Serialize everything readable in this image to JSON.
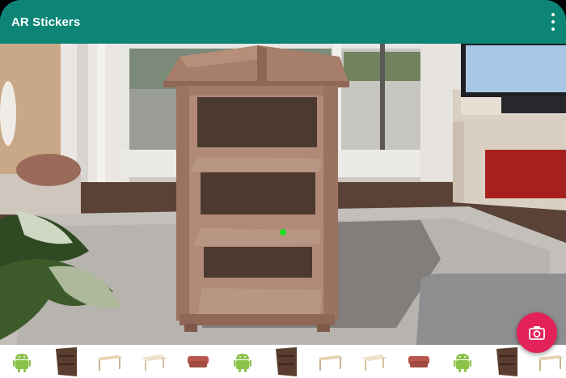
{
  "app": {
    "title": "AR Stickers"
  },
  "menu": {
    "icon": "more-vert-icon"
  },
  "camera_button": {
    "icon": "camera-icon",
    "color": "#e3225a"
  },
  "ar_scene": {
    "placed_object": "bookshelf",
    "tracking_point_color": "#18e024"
  },
  "sticker_tray": {
    "items": [
      {
        "type": "android"
      },
      {
        "type": "bookshelf"
      },
      {
        "type": "desk"
      },
      {
        "type": "table"
      },
      {
        "type": "sofa"
      },
      {
        "type": "android"
      },
      {
        "type": "bookshelf"
      },
      {
        "type": "desk"
      },
      {
        "type": "table"
      },
      {
        "type": "sofa"
      },
      {
        "type": "android"
      },
      {
        "type": "bookshelf"
      },
      {
        "type": "desk"
      }
    ]
  },
  "colors": {
    "app_bar": "#0c8577",
    "fab": "#e3225a"
  }
}
